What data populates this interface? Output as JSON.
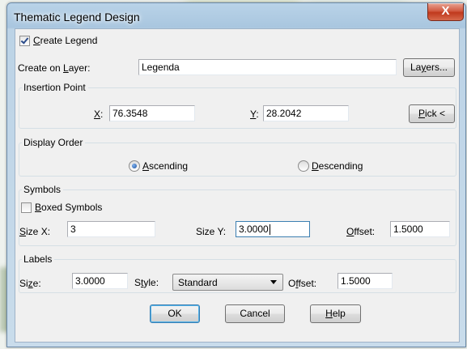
{
  "window": {
    "title": "Thematic Legend Design",
    "close_glyph": "X"
  },
  "create_legend": {
    "checked": true,
    "pre": "",
    "key": "C",
    "post": "reate Legend"
  },
  "layer": {
    "label_pre": "Create on ",
    "label_key": "L",
    "label_post": "ayer:",
    "value": "Legenda",
    "button_pre": "La",
    "button_key": "y",
    "button_post": "ers..."
  },
  "insertion_point": {
    "legend": "Insertion Point",
    "x_key": "X",
    "x_post": ":",
    "x_value": "76.3548",
    "y_key": "Y",
    "y_post": ":",
    "y_value": "28.2042",
    "pick_key": "P",
    "pick_post": "ick <"
  },
  "display_order": {
    "legend": "Display Order",
    "ascending_key": "A",
    "ascending_post": "scending",
    "ascending_selected": true,
    "descending_key": "D",
    "descending_post": "escending",
    "descending_selected": false
  },
  "symbols": {
    "legend": "Symbols",
    "boxed_key": "B",
    "boxed_post": "oxed Symbols",
    "boxed_checked": false,
    "sizex_key": "S",
    "sizex_post": "ize X:",
    "sizex_value": "3",
    "sizey_label": "Size Y:",
    "sizey_value": "3.0000",
    "offset_key": "O",
    "offset_post": "ffset:",
    "offset_value": "1.5000"
  },
  "labels": {
    "legend": "Labels",
    "size_pre": "Si",
    "size_key": "z",
    "size_post": "e:",
    "size_value": "3.0000",
    "style_pre": "S",
    "style_key": "t",
    "style_post": "yle:",
    "style_value": "Standard",
    "offset_pre": "O",
    "offset_key": "f",
    "offset_post": "fset:",
    "offset_value": "1.5000"
  },
  "buttons": {
    "ok": "OK",
    "cancel": "Cancel",
    "help_key": "H",
    "help_post": "elp"
  },
  "colors": {
    "accent": "#3c7fb1",
    "close": "#c0391d",
    "dialog_bg": "#f0f0f0",
    "frame": "#b9d3e8"
  }
}
